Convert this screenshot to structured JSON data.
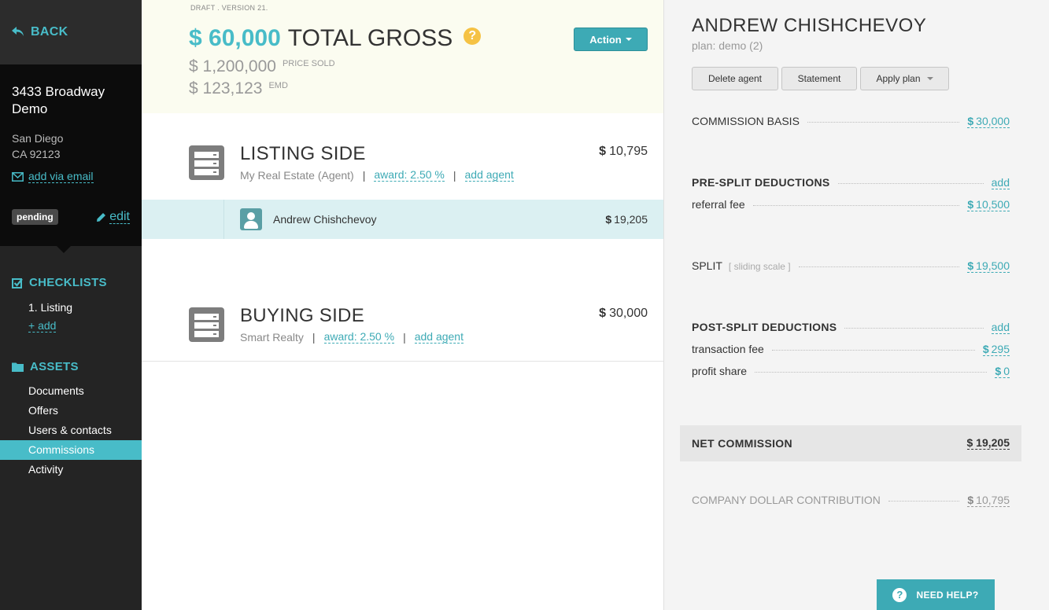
{
  "sidebar": {
    "back_label": "BACK",
    "property_name": "3433 Broadway Demo",
    "city": "San Diego",
    "state_zip": "CA 92123",
    "add_via_email": "add via email",
    "status": "pending",
    "edit_label": "edit",
    "checklists_heading": "CHECKLISTS",
    "checklist_items": [
      "1. Listing"
    ],
    "checklist_add": "+ add",
    "assets_heading": "ASSETS",
    "asset_items": [
      "Documents",
      "Offers",
      "Users & contacts",
      "Commissions",
      "Activity"
    ],
    "active_asset": "Commissions"
  },
  "summary": {
    "draft_label": "DRAFT . VERSION 21.",
    "total_gross_amount": "$ 60,000",
    "total_gross_label": "TOTAL GROSS",
    "price_sold": "$ 1,200,000",
    "price_sold_label": "PRICE SOLD",
    "emd": "$ 123,123",
    "emd_label": "EMD",
    "action_label": "Action"
  },
  "listing_side": {
    "title": "LISTING SIDE",
    "company": "My Real Estate (Agent)",
    "award": "award:  2.50 %",
    "add_agent": "add agent",
    "amount_symbol": "$",
    "amount": "10,795",
    "agent": {
      "name": "Andrew Chishchevoy",
      "amount_symbol": "$",
      "amount": "19,205"
    }
  },
  "buying_side": {
    "title": "BUYING SIDE",
    "company": "Smart Realty",
    "award": "award:  2.50 %",
    "add_agent": "add agent",
    "amount_symbol": "$",
    "amount": "30,000"
  },
  "panel": {
    "agent_name": "ANDREW CHISHCHEVOY",
    "plan": "plan: demo (2)",
    "buttons": {
      "delete": "Delete agent",
      "statement": "Statement",
      "apply_plan": "Apply plan"
    },
    "commission_basis": {
      "label": "COMMISSION BASIS",
      "symbol": "$",
      "value": "30,000"
    },
    "pre_split": {
      "label": "PRE-SPLIT DEDUCTIONS",
      "add": "add"
    },
    "referral_fee": {
      "label": "referral fee",
      "symbol": "$",
      "value": "10,500"
    },
    "split": {
      "label": "SPLIT",
      "hint": "[ sliding scale ]",
      "symbol": "$",
      "value": "19,500"
    },
    "post_split": {
      "label": "POST-SPLIT DEDUCTIONS",
      "add": "add"
    },
    "transaction_fee": {
      "label": "transaction fee",
      "symbol": "$",
      "value": "295"
    },
    "profit_share": {
      "label": "profit share",
      "symbol": "$",
      "value": "0"
    },
    "net_commission": {
      "label": "NET COMMISSION",
      "value": "$ 19,205"
    },
    "company_dollar": {
      "label": "COMPANY DOLLAR CONTRIBUTION",
      "symbol": "$",
      "value": "10,795"
    },
    "need_help": "NEED HELP?"
  },
  "colors": {
    "accent": "#48bcc8",
    "sidebar": "#242424",
    "summary_bg": "#fbfcf0",
    "agent_row": "#dbf0f2",
    "help": "#f5c244"
  }
}
